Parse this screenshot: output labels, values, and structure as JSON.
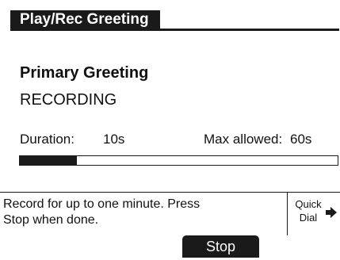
{
  "header": {
    "title": "Play/Rec Greeting"
  },
  "greeting": {
    "name": "Primary Greeting",
    "state": "RECORDING"
  },
  "timing": {
    "duration_label": "Duration:",
    "duration_value": "10s",
    "max_label": "Max allowed:",
    "max_value": "60s",
    "progress_fraction": 0.18
  },
  "info": {
    "line1": "Record for up to one minute. Press",
    "line2": "Stop when done."
  },
  "quick_dial": {
    "line1": "Quick",
    "line2": "Dial",
    "icon": "arrow-right-icon"
  },
  "softkeys": {
    "stop_label": "Stop"
  },
  "colors": {
    "foreground": "#1a1a1a",
    "background": "#ffffff"
  }
}
